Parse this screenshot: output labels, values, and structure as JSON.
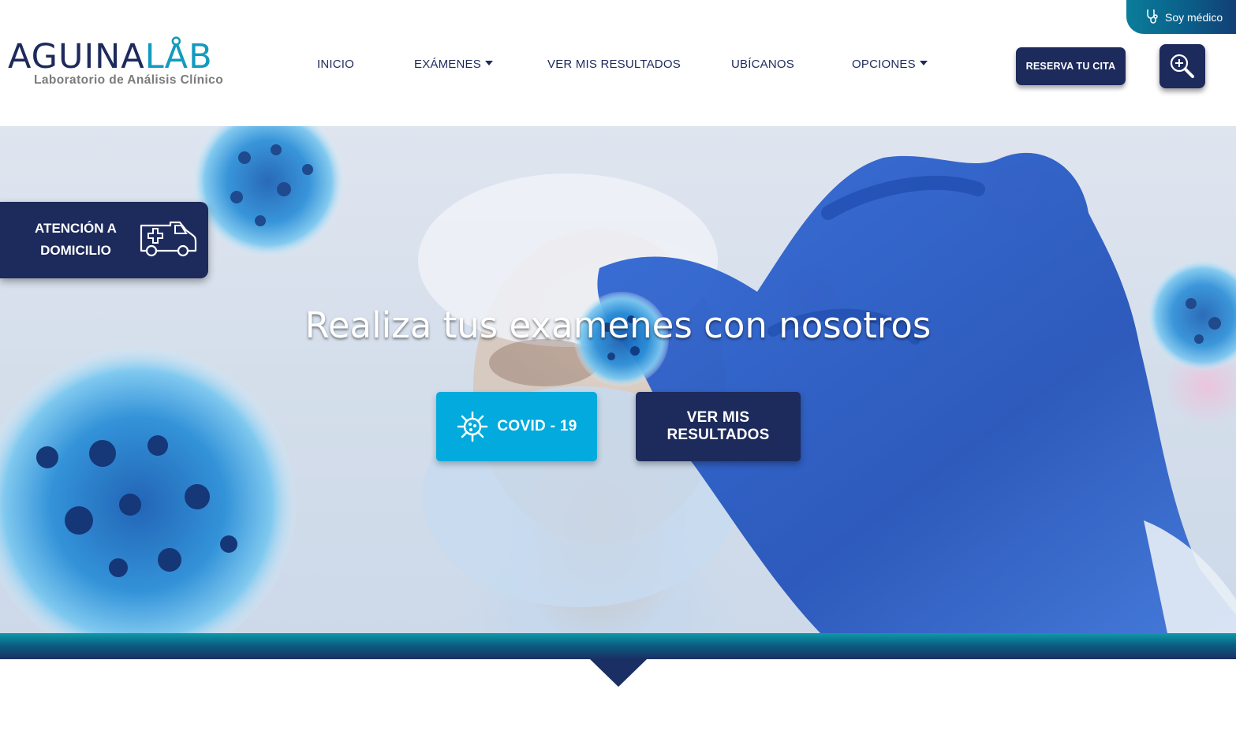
{
  "top_tab": {
    "label": "Soy médico",
    "icon": "stethoscope-icon"
  },
  "brand": {
    "name_part1": "AGUINA",
    "name_part2": "LÅB",
    "tagline": "Laboratorio de Análisis Clínico",
    "color_primary": "#1d2a5c",
    "color_accent": "#129bbd"
  },
  "nav": {
    "items": [
      {
        "label": "INICIO",
        "has_dropdown": false
      },
      {
        "label": "EXÁMENES",
        "has_dropdown": true
      },
      {
        "label": "VER MIS RESULTADOS",
        "has_dropdown": false
      },
      {
        "label": "UBÍCANOS",
        "has_dropdown": false
      },
      {
        "label": "OPCIONES",
        "has_dropdown": true
      }
    ]
  },
  "header": {
    "reserve_button": "RESERVA TU CITA",
    "search_icon": "zoom-in-icon"
  },
  "hero": {
    "title": "Realiza tus examenes con nosotros",
    "home_service": {
      "label": "ATENCIÓN A DOMICILIO",
      "icon": "ambulance-icon"
    },
    "covid_button": {
      "label": "COVID - 19",
      "icon": "virus-icon",
      "color": "#02aadd"
    },
    "results_button": {
      "label": "VER MIS RESULTADOS",
      "color": "#1d2a5c"
    }
  }
}
